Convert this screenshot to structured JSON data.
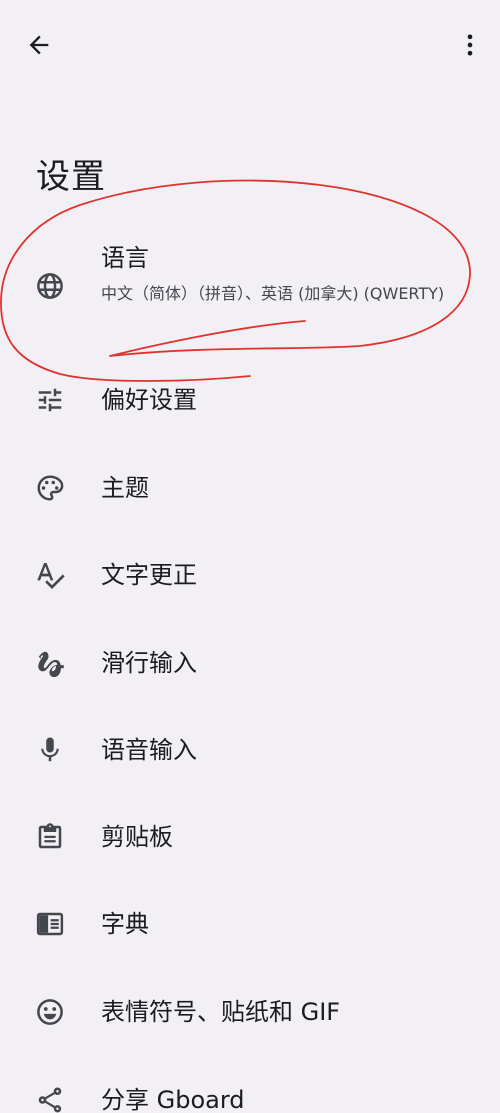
{
  "header": {
    "back_icon": "arrow-back-icon",
    "more_icon": "more-vert-icon",
    "title": "设置"
  },
  "settings": {
    "items": [
      {
        "icon": "globe-icon",
        "label": "语言",
        "subtitle": "中文（简体）（拼音）、英语 (加拿大) (QWERTY)"
      },
      {
        "icon": "tune-sliders-icon",
        "label": "偏好设置"
      },
      {
        "icon": "palette-icon",
        "label": "主题"
      },
      {
        "icon": "spellcheck-icon",
        "label": "文字更正"
      },
      {
        "icon": "gesture-icon",
        "label": "滑行输入"
      },
      {
        "icon": "mic-icon",
        "label": "语音输入"
      },
      {
        "icon": "clipboard-icon",
        "label": "剪贴板"
      },
      {
        "icon": "dictionary-book-icon",
        "label": "字典"
      },
      {
        "icon": "emoji-face-icon",
        "label": "表情符号、贴纸和 GIF"
      },
      {
        "icon": "share-icon",
        "label": "分享 Gboard"
      }
    ]
  },
  "colors": {
    "background": "#f2f0f4",
    "text": "#1c1b1f",
    "subtext": "#46464f",
    "icon": "#44474e",
    "annotation": "#e0332f"
  }
}
